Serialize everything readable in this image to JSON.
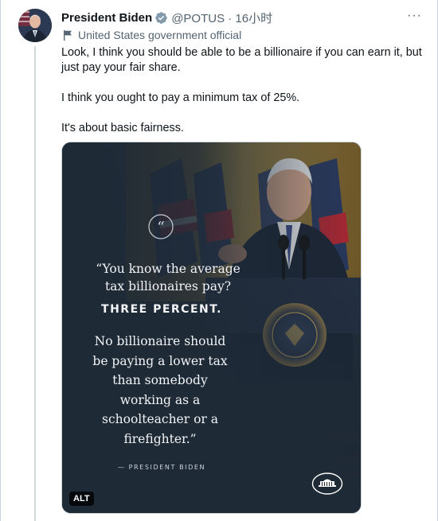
{
  "tweet": {
    "author_name": "President Biden",
    "handle_time": "@POTUS · 16小时",
    "affiliation": "United States government official",
    "more_label": "···",
    "paragraphs": [
      "Look, I think you should be able to be a billionaire if you can earn it, but just pay your fair share.",
      "I think you ought to pay a minimum tax of 25%.",
      "It's about basic fairness."
    ]
  },
  "media": {
    "quote_line1": "“You know the average tax billionaires pay?",
    "quote_line2": "THREE PERCENT.",
    "quote_line3": "No billionaire should be paying a lower tax than somebody working as a schoolteacher or a firefighter.”",
    "attribution": "— PRESIDENT BIDEN",
    "alt_label": "ALT"
  },
  "colors": {
    "verified_blue": "#1d9bf0",
    "secondary_text": "#536471",
    "card_dark": "#1e2a36"
  }
}
